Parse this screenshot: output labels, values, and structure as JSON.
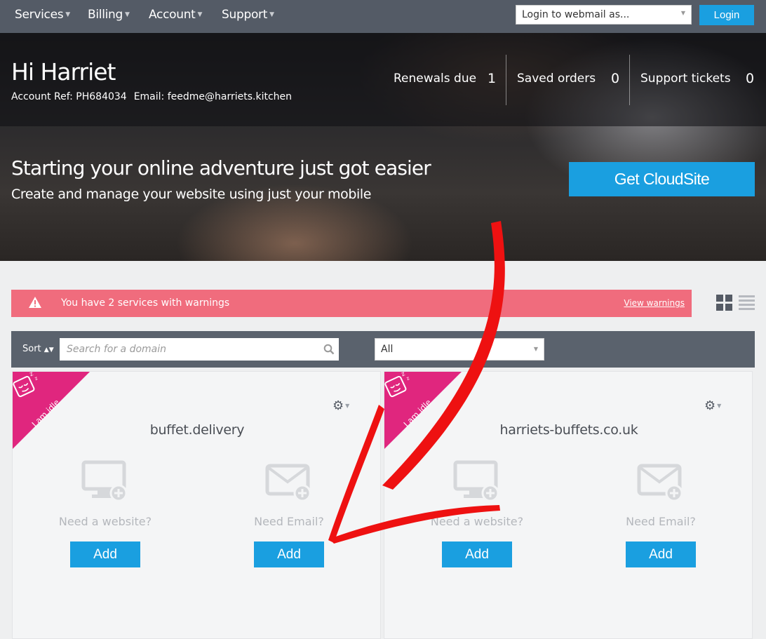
{
  "nav": {
    "items": [
      {
        "label": "Services"
      },
      {
        "label": "Billing"
      },
      {
        "label": "Account"
      },
      {
        "label": "Support"
      }
    ],
    "webmail_placeholder": "Login to webmail as...",
    "login_label": "Login"
  },
  "hero": {
    "greeting": "Hi Harriet",
    "account_ref": "Account Ref: PH684034",
    "email": "Email: feedme@harriets.kitchen",
    "stats": [
      {
        "label": "Renewals due",
        "value": "1"
      },
      {
        "label": "Saved orders",
        "value": "0"
      },
      {
        "label": "Support tickets",
        "value": "0"
      }
    ],
    "promo_title": "Starting your online adventure just got easier",
    "promo_subtitle": "Create and manage your website using just your mobile",
    "cta_label": "Get CloudSite"
  },
  "warning": {
    "text": "You have 2 services with warnings",
    "link": "View warnings",
    "color": "#f06c7d"
  },
  "toolbar": {
    "sort_label": "Sort",
    "search_placeholder": "Search for a domain",
    "filter_value": "All"
  },
  "cards": [
    {
      "ribbon": "I am idle",
      "domain": "buffet.delivery",
      "website_label": "Need a website?",
      "email_label": "Need Email?",
      "add_website": "Add",
      "add_email": "Add"
    },
    {
      "ribbon": "I am idle",
      "domain": "harriets-buffets.co.uk",
      "website_label": "Need a website?",
      "email_label": "Need Email?",
      "add_website": "Add",
      "add_email": "Add"
    }
  ],
  "colors": {
    "nav_bg": "#545b66",
    "accent_blue": "#1a9fe0",
    "ribbon_pink": "#e0267e",
    "annotation_red": "#ee1111"
  }
}
